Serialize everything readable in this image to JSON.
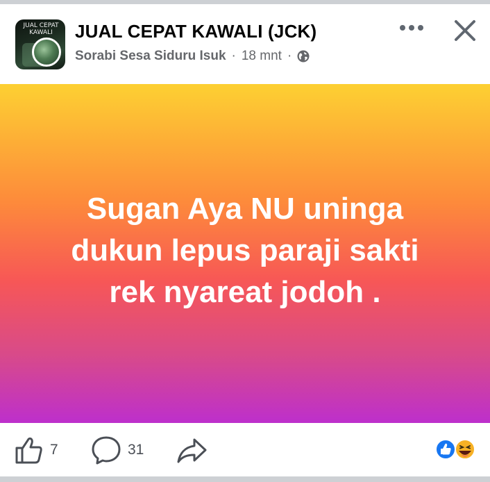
{
  "header": {
    "group_name": "JUAL CEPAT KAWALI (JCK)",
    "author": "Sorabi Sesa Siduru Isuk",
    "time": "18 mnt",
    "separator": "·",
    "avatar_text": "JUAL CEPAT KAWALI"
  },
  "post": {
    "text": "Sugan Aya NU uninga\ndukun lepus paraji sakti\nrek nyareat jodoh .",
    "gradient_colors": [
      "#fdd032",
      "#fd8a3b",
      "#f75756",
      "#d84a8a",
      "#bd2fcc"
    ]
  },
  "actions": {
    "like_count": "7",
    "comment_count": "31"
  },
  "icons": {
    "more": "more-horizontal-icon",
    "close": "close-icon",
    "privacy": "globe-icon",
    "like": "thumbs-up-icon",
    "comment": "comment-bubble-icon",
    "share": "share-arrow-icon",
    "reactions": [
      "like-reaction-icon",
      "haha-reaction-icon"
    ]
  },
  "colors": {
    "like_blue": "#1877f2",
    "secondary_text": "#65676b",
    "divider": "#cdd0d4"
  }
}
